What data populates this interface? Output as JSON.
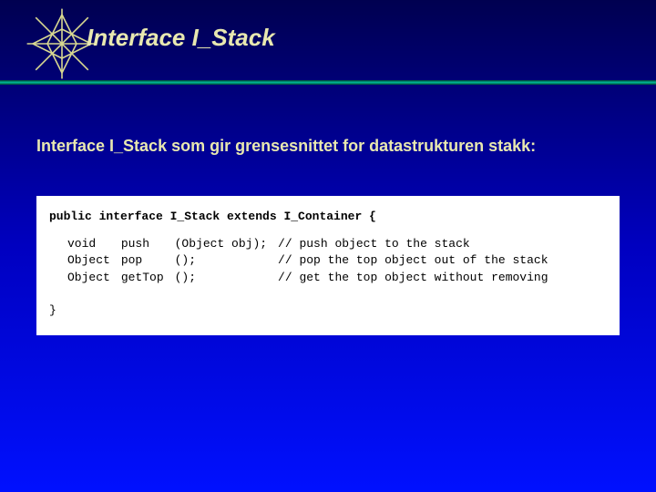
{
  "slide": {
    "title": "Interface   I_Stack",
    "subtitle": "Interface I_Stack som gir grensesnittet for datastrukturen stakk:"
  },
  "code": {
    "signature": "public interface I_Stack extends I_Container {",
    "methods": [
      {
        "ret": "void",
        "name": "push",
        "args": "(Object obj);",
        "comment": "// push object to the stack"
      },
      {
        "ret": "Object",
        "name": "pop",
        "args": "();",
        "comment": "// pop the top object out of the stack"
      },
      {
        "ret": "Object",
        "name": "getTop",
        "args": "();",
        "comment": "// get the top object without removing"
      }
    ],
    "close": "}"
  }
}
